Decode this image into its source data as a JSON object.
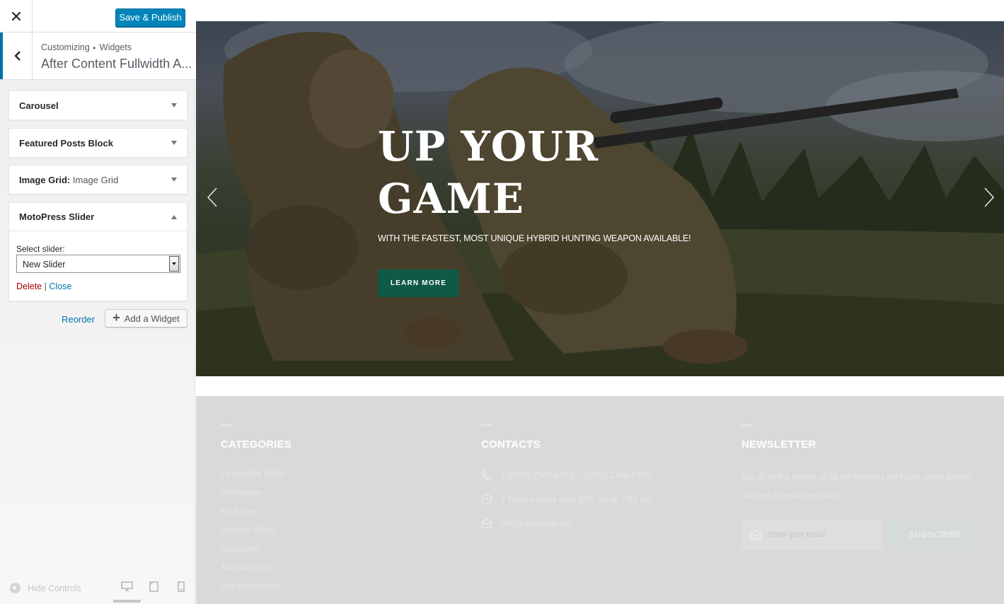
{
  "customizer": {
    "publish_label": "Save & Publish",
    "breadcrumb": {
      "root": "Customizing",
      "separator": "▸",
      "current": "Widgets"
    },
    "section_title": "After Content Fullwidth A...",
    "widgets": [
      {
        "title": "Carousel",
        "sub": ""
      },
      {
        "title": "Featured Posts Block",
        "sub": ""
      },
      {
        "title": "Image Grid:",
        "sub": "Image Grid"
      },
      {
        "title": "MotoPress Slider",
        "sub": ""
      }
    ],
    "slider_widget": {
      "select_label": "Select slider:",
      "selected": "New Slider",
      "delete_label": "Delete",
      "separator": "|",
      "close_label": "Close"
    },
    "reorder_label": "Reorder",
    "add_widget_label": "Add a Widget",
    "hide_controls_label": "Hide Controls",
    "accent_color": "#0085ba"
  },
  "preview": {
    "hero": {
      "title_line1": "UP YOUR",
      "title_line2": "GAME",
      "subtitle": "WITH THE FASTEST, MOST UNIQUE HYBRID HUNTING WEAPON AVAILABLE!",
      "button_label": "LEARN MORE",
      "button_color": "#0f5a44"
    },
    "footer": {
      "categories": {
        "heading": "CATEGORIES",
        "items": [
          "Centerfire Rifles",
          "Handguns",
          "Packages",
          "Rimfire Rifles",
          "Shotguns",
          "Tactical Guns",
          "Uncategorized"
        ]
      },
      "contacts": {
        "heading": "CONTACTS",
        "phone": "+3(800) 2345-6789; +3(800) 2345-6790",
        "hours": "7 Days a week from 9:00 am to 7:00 pm",
        "email": "info@demolink.org"
      },
      "newsletter": {
        "heading": "NEWSLETTER",
        "text": "Out of all the variety of all the firearms we have, some indeed achieve a bestseller status.",
        "email_placeholder": "Enter your email",
        "subscribe_label": "SUBSCRIBE"
      }
    }
  }
}
